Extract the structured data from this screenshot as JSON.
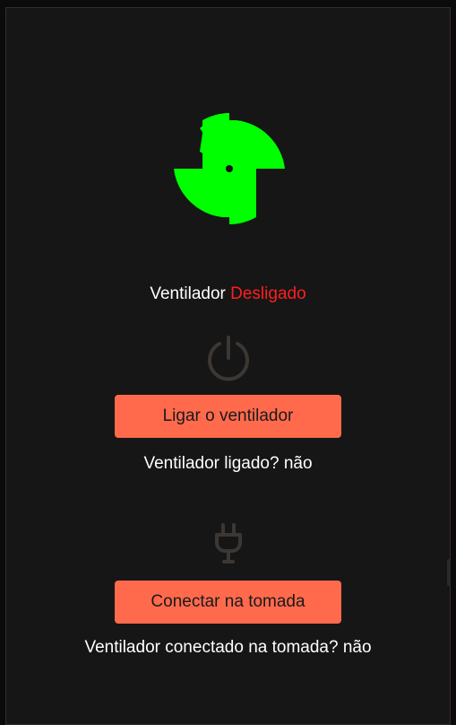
{
  "fan": {
    "icon": "fan-icon",
    "color": "#00ff00"
  },
  "status": {
    "label": "Ventilador",
    "state": "Desligado",
    "state_color": "#ff1e1e"
  },
  "power": {
    "icon": "power-icon",
    "button_label": "Ligar o ventilador",
    "info_label": "Ventilador ligado?",
    "info_value": "não"
  },
  "plug": {
    "icon": "plug-icon",
    "button_label": "Conectar na tomada",
    "info_label": "Ventilador conectado na tomada?",
    "info_value": "não"
  },
  "colors": {
    "background": "#161616",
    "button": "#ff6a4d",
    "icon_muted": "#3d3733"
  }
}
